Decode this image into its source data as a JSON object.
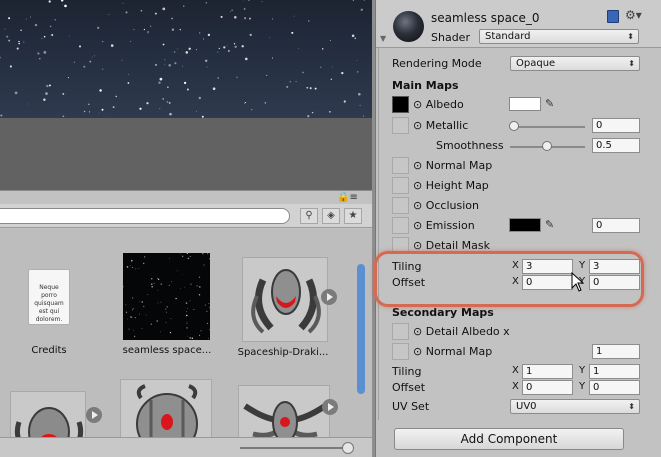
{
  "inspector": {
    "material_name": "seamless space_0",
    "shader_label": "Shader",
    "shader_value": "Standard",
    "rendering_mode_label": "Rendering Mode",
    "rendering_mode_value": "Opaque",
    "main_maps_title": "Main Maps",
    "albedo_label": "Albedo",
    "albedo_color": "#ffffff",
    "metallic_label": "Metallic",
    "metallic_value": "0",
    "smoothness_label": "Smoothness",
    "smoothness_value": "0.5",
    "normal_map_label": "Normal Map",
    "height_map_label": "Height Map",
    "occlusion_label": "Occlusion",
    "emission_label": "Emission",
    "emission_color": "#000000",
    "emission_value": "0",
    "detail_mask_label": "Detail Mask",
    "tiling_label": "Tiling",
    "offset_label": "Offset",
    "x_label": "X",
    "y_label": "Y",
    "main_tiling_x": "3",
    "main_tiling_y": "3",
    "main_offset_x": "0",
    "main_offset_y": "0",
    "secondary_maps_title": "Secondary Maps",
    "detail_albedo_label": "Detail Albedo x",
    "secondary_normal_label": "Normal Map",
    "secondary_normal_value": "1",
    "sec_tiling_x": "1",
    "sec_tiling_y": "1",
    "sec_offset_x": "0",
    "sec_offset_y": "0",
    "uv_set_label": "UV Set",
    "uv_set_value": "UV0",
    "add_component_label": "Add Component",
    "highlight_color": "#d46a52"
  },
  "project": {
    "assets": [
      {
        "label": "Credits",
        "doc_text": "Neque porro quisquam est qui dolorem."
      },
      {
        "label": "seamless space..."
      },
      {
        "label": "Spaceship-Draki..."
      }
    ]
  },
  "icons": [
    "gear-icon",
    "book-icon",
    "lock-icon",
    "eyedropper-icon",
    "play-icon",
    "search-icon",
    "star-icon",
    "tag-icon"
  ]
}
